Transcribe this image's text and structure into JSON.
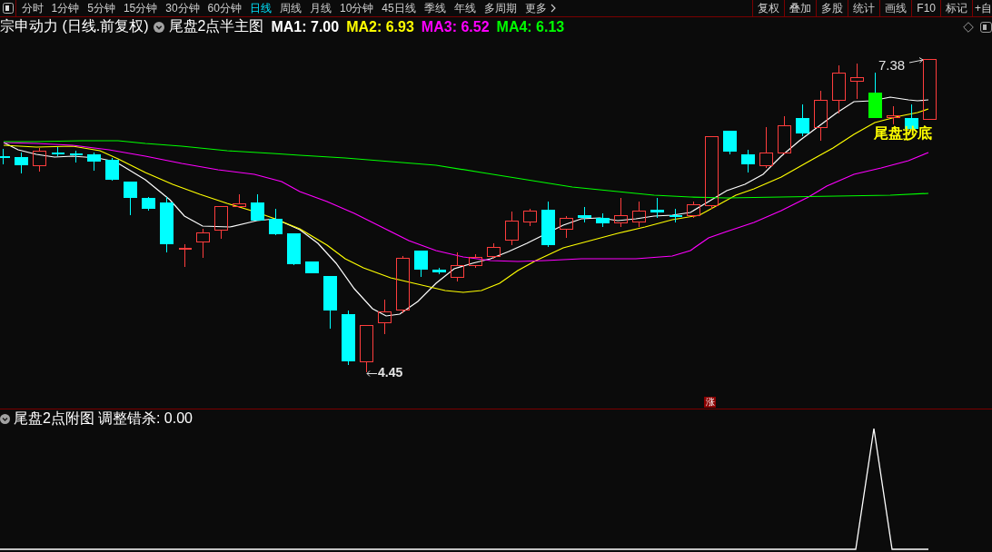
{
  "toolbar": {
    "periods": [
      {
        "label": "分时",
        "selected": false
      },
      {
        "label": "1分钟",
        "selected": false
      },
      {
        "label": "5分钟",
        "selected": false
      },
      {
        "label": "15分钟",
        "selected": false
      },
      {
        "label": "30分钟",
        "selected": false
      },
      {
        "label": "60分钟",
        "selected": false
      },
      {
        "label": "日线",
        "selected": true
      },
      {
        "label": "周线",
        "selected": false
      },
      {
        "label": "月线",
        "selected": false
      },
      {
        "label": "10分钟",
        "selected": false
      },
      {
        "label": "45日线",
        "selected": false
      },
      {
        "label": "季线",
        "selected": false
      },
      {
        "label": "年线",
        "selected": false
      },
      {
        "label": "多周期",
        "selected": false
      }
    ],
    "more": "更多",
    "tools": [
      "复权",
      "叠加",
      "多股",
      "统计",
      "画线",
      "F10",
      "标记",
      "+自"
    ]
  },
  "header": {
    "title": "宗申动力 (日线.前复权)",
    "indicator": "尾盘2点半主图",
    "averages": [
      {
        "label": "MA1: 7.00",
        "color": "#ffffff"
      },
      {
        "label": "MA2: 6.93",
        "color": "#ffff00"
      },
      {
        "label": "MA3: 6.52",
        "color": "#ff00ff"
      },
      {
        "label": "MA4: 6.13",
        "color": "#00ff00"
      }
    ]
  },
  "main_chart": {
    "high_label": "7.38",
    "low_label": "4.45",
    "signal_label": "尾盘抄底",
    "rise_marker": "涨"
  },
  "sub_panel": {
    "indicator": "尾盘2点附图",
    "reading": "调整错杀: 0.00"
  }
}
